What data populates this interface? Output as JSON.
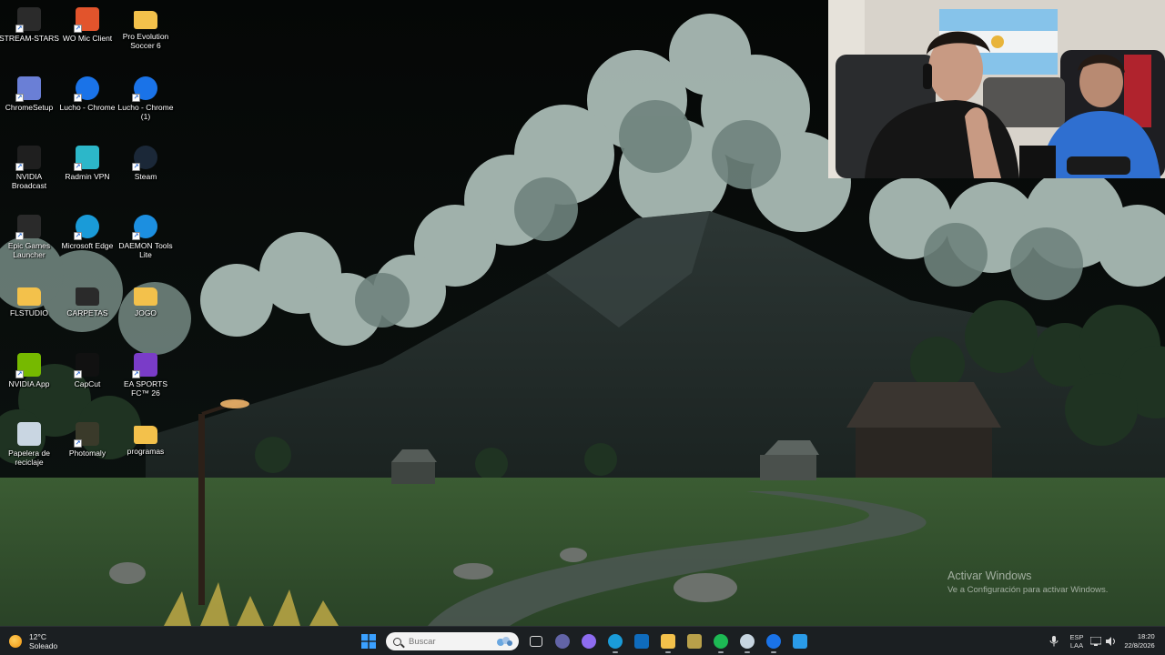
{
  "desktop": {
    "icons": [
      {
        "label": "STREAM-STARS",
        "icon": "stream-stars-icon",
        "color": "#2b2b2b"
      },
      {
        "label": "WO Mic Client",
        "icon": "microphone-icon",
        "color": "#e2542c"
      },
      {
        "label": "Pro Evolution Soccer 6",
        "icon": "folder-icon",
        "color": "#f3c14b"
      },
      {
        "label": "ChromeSetup",
        "icon": "installer-icon",
        "color": "#6a7fd6"
      },
      {
        "label": "Lucho - Chrome",
        "icon": "chrome-icon",
        "color": "#1a73e8"
      },
      {
        "label": "Lucho - Chrome (1)",
        "icon": "chrome-icon",
        "color": "#1a73e8"
      },
      {
        "label": "NVIDIA Broadcast",
        "icon": "nvidia-broadcast-icon",
        "color": "#1f1f1f"
      },
      {
        "label": "Radmin VPN",
        "icon": "radmin-vpn-icon",
        "color": "#2cb7c9"
      },
      {
        "label": "Steam",
        "icon": "steam-icon",
        "color": "#1b2838"
      },
      {
        "label": "Epic Games Launcher",
        "icon": "epic-games-icon",
        "color": "#2a2a2a"
      },
      {
        "label": "Microsoft Edge",
        "icon": "edge-icon",
        "color": "#1a9bd8"
      },
      {
        "label": "DAEMON Tools Lite",
        "icon": "daemon-tools-icon",
        "color": "#1c8fe0"
      },
      {
        "label": "FLSTUDIO",
        "icon": "folder-icon",
        "color": "#f3c14b"
      },
      {
        "label": "CARPETAS",
        "icon": "folder-dark-icon",
        "color": "#2a2a2a"
      },
      {
        "label": "JOGO",
        "icon": "folder-icon",
        "color": "#f3c14b"
      },
      {
        "label": "NVIDIA App",
        "icon": "nvidia-icon",
        "color": "#76b900"
      },
      {
        "label": "CapCut",
        "icon": "capcut-icon",
        "color": "#111111"
      },
      {
        "label": "EA SPORTS FC™ 26",
        "icon": "ea-sports-fc-icon",
        "color": "#7a3cc8"
      },
      {
        "label": "Papelera de reciclaje",
        "icon": "recycle-bin-icon",
        "color": "#c9d6e2"
      },
      {
        "label": "Photomaly",
        "icon": "photomaly-icon",
        "color": "#3a3a2a"
      },
      {
        "label": "programas",
        "icon": "folder-icon",
        "color": "#f3c14b"
      }
    ]
  },
  "watermark": {
    "title": "Activar Windows",
    "subtitle": "Ve a Configuración para activar Windows."
  },
  "taskbar": {
    "weather_temp": "12°C",
    "weather_desc": "Soleado",
    "search_placeholder": "Buscar",
    "apps": [
      {
        "name": "task-view-icon",
        "color": "#dddddd"
      },
      {
        "name": "teams-icon",
        "color": "#6264a7"
      },
      {
        "name": "copilot-icon",
        "color": "#8e6cf0"
      },
      {
        "name": "edge-icon",
        "color": "#1a9bd8"
      },
      {
        "name": "outlook-icon",
        "color": "#0f6cbd"
      },
      {
        "name": "file-explorer-icon",
        "color": "#f3c14b"
      },
      {
        "name": "photomaly-icon",
        "color": "#b8a04a"
      },
      {
        "name": "spotify-icon",
        "color": "#1db954"
      },
      {
        "name": "steam-icon",
        "color": "#c7d5e0"
      },
      {
        "name": "chrome-icon",
        "color": "#1a73e8"
      },
      {
        "name": "daemon-tools-icon",
        "color": "#2a9be8"
      }
    ],
    "language_1": "ESP",
    "language_2": "LAA",
    "time": "18:20",
    "date": "22/8/2026"
  },
  "colors": {
    "taskbar_bg": "#1b1f22",
    "accent": "#0078d4"
  }
}
